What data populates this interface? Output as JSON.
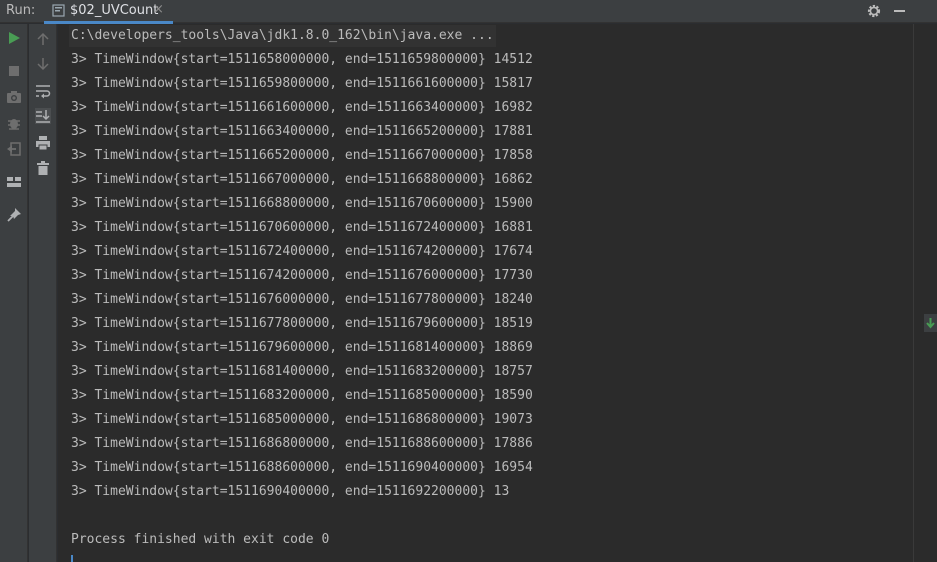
{
  "header": {
    "run_label": "Run:",
    "tab_title": "$02_UVCount",
    "tab_close": "×"
  },
  "icons": {
    "left_toolbar": [
      "run-icon",
      "stop-icon",
      "camera-icon",
      "debug-icon",
      "exit-icon",
      "layout-icon",
      "pin-icon"
    ],
    "second_toolbar": [
      "arrow-up-icon",
      "arrow-down-icon",
      "soft-wrap-icon",
      "scroll-to-end-icon",
      "print-icon",
      "trash-icon"
    ]
  },
  "colors": {
    "run_green": "#499c54",
    "accent_blue": "#4a88c7",
    "console_bg": "#2b2b2b"
  },
  "console": {
    "command": "C:\\developers_tools\\Java\\jdk1.8.0_162\\bin\\java.exe ...",
    "lines": [
      "3> TimeWindow{start=1511658000000, end=1511659800000} 14512",
      "3> TimeWindow{start=1511659800000, end=1511661600000} 15817",
      "3> TimeWindow{start=1511661600000, end=1511663400000} 16982",
      "3> TimeWindow{start=1511663400000, end=1511665200000} 17881",
      "3> TimeWindow{start=1511665200000, end=1511667000000} 17858",
      "3> TimeWindow{start=1511667000000, end=1511668800000} 16862",
      "3> TimeWindow{start=1511668800000, end=1511670600000} 15900",
      "3> TimeWindow{start=1511670600000, end=1511672400000} 16881",
      "3> TimeWindow{start=1511672400000, end=1511674200000} 17674",
      "3> TimeWindow{start=1511674200000, end=1511676000000} 17730",
      "3> TimeWindow{start=1511676000000, end=1511677800000} 18240",
      "3> TimeWindow{start=1511677800000, end=1511679600000} 18519",
      "3> TimeWindow{start=1511679600000, end=1511681400000} 18869",
      "3> TimeWindow{start=1511681400000, end=1511683200000} 18757",
      "3> TimeWindow{start=1511683200000, end=1511685000000} 18590",
      "3> TimeWindow{start=1511685000000, end=1511686800000} 19073",
      "3> TimeWindow{start=1511686800000, end=1511688600000} 17886",
      "3> TimeWindow{start=1511688600000, end=1511690400000} 16954",
      "3> TimeWindow{start=1511690400000, end=1511692200000} 13"
    ],
    "finish_message": "Process finished with exit code 0"
  }
}
